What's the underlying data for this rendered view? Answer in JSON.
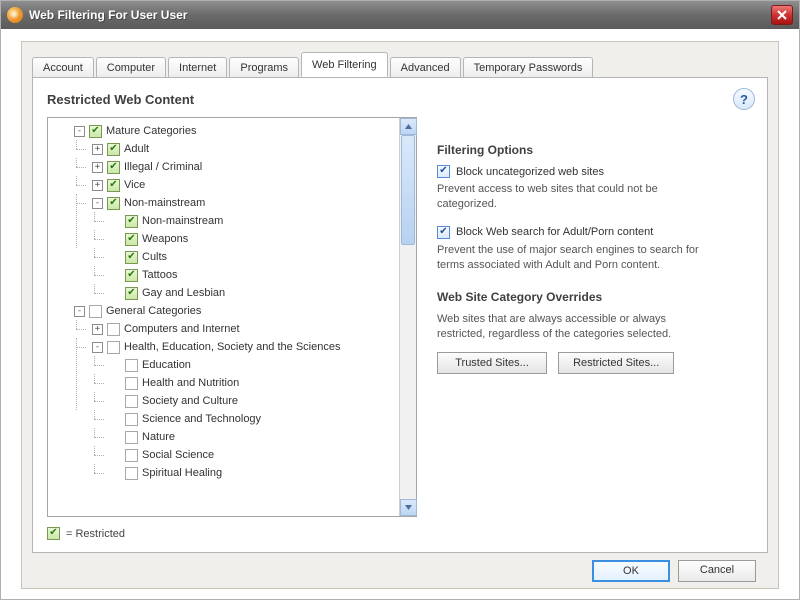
{
  "window": {
    "title": "Web Filtering For User User"
  },
  "tabs": [
    {
      "label": "Account",
      "active": false
    },
    {
      "label": "Computer",
      "active": false
    },
    {
      "label": "Internet",
      "active": false
    },
    {
      "label": "Programs",
      "active": false
    },
    {
      "label": "Web Filtering",
      "active": true
    },
    {
      "label": "Advanced",
      "active": false
    },
    {
      "label": "Temporary Passwords",
      "active": false
    }
  ],
  "panel": {
    "heading": "Restricted Web Content",
    "help_glyph": "?"
  },
  "tree": [
    {
      "label": "Mature Categories",
      "checked": true,
      "expander": "-",
      "children": [
        {
          "label": "Adult",
          "checked": true,
          "expander": "+"
        },
        {
          "label": "Illegal / Criminal",
          "checked": true,
          "expander": "+"
        },
        {
          "label": "Vice",
          "checked": true,
          "expander": "+"
        },
        {
          "label": "Non-mainstream",
          "checked": true,
          "expander": "-",
          "children": [
            {
              "label": "Non-mainstream",
              "checked": true,
              "expander": ""
            },
            {
              "label": "Weapons",
              "checked": true,
              "expander": ""
            },
            {
              "label": "Cults",
              "checked": true,
              "expander": ""
            },
            {
              "label": "Tattoos",
              "checked": true,
              "expander": ""
            },
            {
              "label": "Gay and Lesbian",
              "checked": true,
              "expander": ""
            }
          ]
        }
      ]
    },
    {
      "label": "General Categories",
      "checked": false,
      "expander": "-",
      "children": [
        {
          "label": "Computers and Internet",
          "checked": false,
          "expander": "+"
        },
        {
          "label": "Health, Education, Society and the Sciences",
          "checked": false,
          "expander": "-",
          "children": [
            {
              "label": "Education",
              "checked": false,
              "expander": ""
            },
            {
              "label": "Health and Nutrition",
              "checked": false,
              "expander": ""
            },
            {
              "label": "Society and Culture",
              "checked": false,
              "expander": ""
            },
            {
              "label": "Science and Technology",
              "checked": false,
              "expander": ""
            },
            {
              "label": "Nature",
              "checked": false,
              "expander": ""
            },
            {
              "label": "Social Science",
              "checked": false,
              "expander": ""
            },
            {
              "label": "Spiritual Healing",
              "checked": false,
              "expander": ""
            }
          ]
        }
      ]
    }
  ],
  "legend": {
    "label": "= Restricted"
  },
  "filtering": {
    "heading": "Filtering Options",
    "opt1_label": "Block uncategorized web sites",
    "opt1_checked": true,
    "opt1_desc": "Prevent access to web sites that could not be categorized.",
    "opt2_label": "Block Web search for Adult/Porn content",
    "opt2_checked": true,
    "opt2_desc": "Prevent the use of major search engines to search for terms associated with Adult and Porn content."
  },
  "overrides": {
    "heading": "Web Site Category Overrides",
    "desc": "Web sites that are always accessible or always restricted, regardless of the categories selected.",
    "trusted_btn": "Trusted Sites...",
    "restricted_btn": "Restricted Sites..."
  },
  "buttons": {
    "ok": "OK",
    "cancel": "Cancel"
  }
}
